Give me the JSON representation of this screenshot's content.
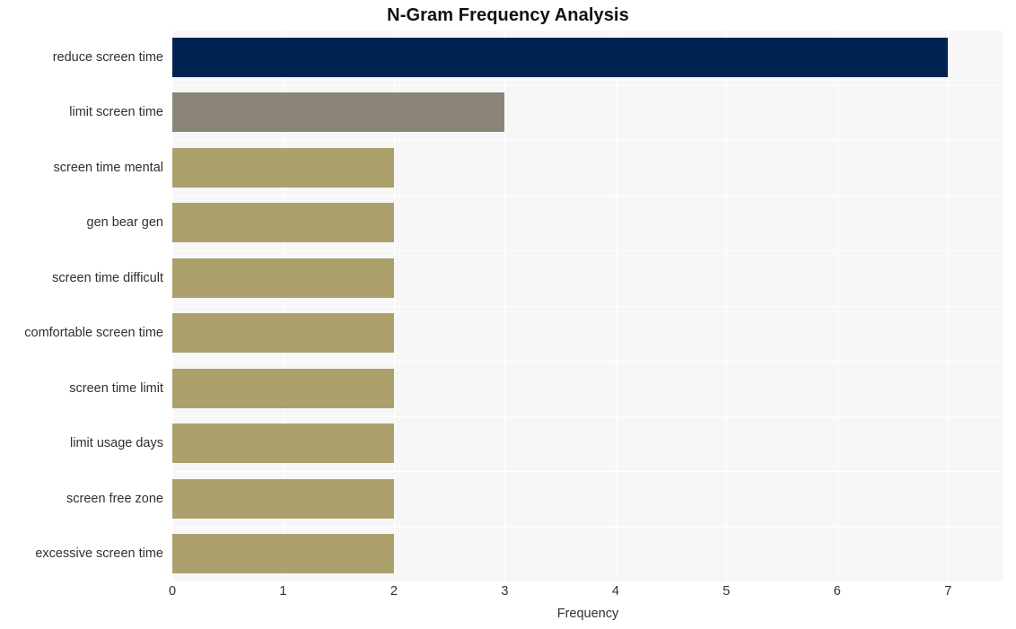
{
  "chart_data": {
    "type": "bar",
    "orientation": "horizontal",
    "title": "N-Gram Frequency Analysis",
    "xlabel": "Frequency",
    "ylabel": "",
    "xlim": [
      0,
      7.5
    ],
    "grid": true,
    "legend": null,
    "categories": [
      "reduce screen time",
      "limit screen time",
      "screen time mental",
      "gen bear gen",
      "screen time difficult",
      "comfortable screen time",
      "screen time limit",
      "limit usage days",
      "screen free zone",
      "excessive screen time"
    ],
    "values": [
      7,
      3,
      2,
      2,
      2,
      2,
      2,
      2,
      2,
      2
    ],
    "bar_colors": [
      "#002452",
      "#8b8578",
      "#aca16c",
      "#aca16c",
      "#aca16c",
      "#aca16c",
      "#aca16c",
      "#aca16c",
      "#aca16c",
      "#aca16c"
    ],
    "xticks": [
      0,
      1,
      2,
      3,
      4,
      5,
      6,
      7
    ],
    "xtick_labels": [
      "0",
      "1",
      "2",
      "3",
      "4",
      "5",
      "6",
      "7"
    ],
    "plot_background": "#f7f7f7",
    "gridline_color": "#ffffff",
    "figure_background": "#ffffff"
  }
}
